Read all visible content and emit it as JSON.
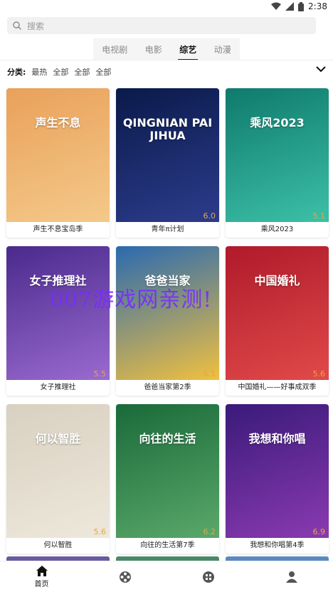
{
  "status": {
    "time": "2:38"
  },
  "search": {
    "placeholder": "搜索"
  },
  "tabs": [
    {
      "label": "电视剧",
      "active": false
    },
    {
      "label": "电影",
      "active": false
    },
    {
      "label": "综艺",
      "active": true
    },
    {
      "label": "动漫",
      "active": false
    }
  ],
  "filters": {
    "label": "分类:",
    "options": [
      "最热",
      "全部",
      "全部",
      "全部"
    ]
  },
  "cards": [
    {
      "title": "声生不息宝岛季",
      "score": "",
      "poster_text": "声生不息",
      "colors": [
        "#e9a15a",
        "#f4c98a"
      ]
    },
    {
      "title": "青年π计划",
      "score": "6.0",
      "poster_text": "QINGNIAN PAI JIHUA",
      "colors": [
        "#0a1a4a",
        "#2c3c8c"
      ]
    },
    {
      "title": "乘风2023",
      "score": "5.1",
      "poster_text": "乘风2023",
      "colors": [
        "#0f7a6c",
        "#3cc0a8"
      ]
    },
    {
      "title": "女子推理社",
      "score": "5.5",
      "poster_text": "女子推理社",
      "colors": [
        "#4a2a8c",
        "#9a6ad0"
      ]
    },
    {
      "title": "爸爸当家第2季",
      "score": "6.1",
      "poster_text": "爸爸当家",
      "colors": [
        "#2a6ab0",
        "#f0c040"
      ]
    },
    {
      "title": "中国婚礼——好事成双季",
      "score": "5.6",
      "poster_text": "中国婚礼",
      "colors": [
        "#b01a2a",
        "#e04a4a"
      ]
    },
    {
      "title": "何以智胜",
      "score": "5.6",
      "poster_text": "何以智胜",
      "colors": [
        "#d8d0c0",
        "#eee8dc"
      ]
    },
    {
      "title": "向往的生活第7季",
      "score": "6.2",
      "poster_text": "向往的生活",
      "colors": [
        "#1a6a3a",
        "#5aa86a"
      ]
    },
    {
      "title": "我想和你唱第4季",
      "score": "6.9",
      "poster_text": "我想和你唱",
      "colors": [
        "#3a1a7a",
        "#8a3ab0"
      ]
    }
  ],
  "watermark": "007游戏网亲测!",
  "nav": [
    {
      "label": "首页",
      "icon": "home-icon"
    },
    {
      "label": "",
      "icon": "film-reel-icon"
    },
    {
      "label": "",
      "icon": "grid-icon"
    },
    {
      "label": "",
      "icon": "user-icon"
    }
  ]
}
